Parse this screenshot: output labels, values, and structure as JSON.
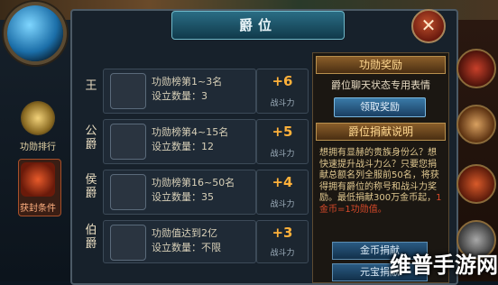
{
  "title": "爵位",
  "close_glyph": "✕",
  "left_menu": [
    {
      "label": "功勋排行"
    },
    {
      "label": "获封条件"
    }
  ],
  "ranks": [
    {
      "rank": "王",
      "line1": "功勋榜第1~3名",
      "line2": "设立数量：3",
      "power": "+6",
      "power_label": "战斗力"
    },
    {
      "rank": "公爵",
      "line1": "功勋榜第4~15名",
      "line2": "设立数量：12",
      "power": "+5",
      "power_label": "战斗力"
    },
    {
      "rank": "侯爵",
      "line1": "功勋榜第16~50名",
      "line2": "设立数量：35",
      "power": "+4",
      "power_label": "战斗力"
    },
    {
      "rank": "伯爵",
      "line1": "功勋值达到2亿",
      "line2": "设立数量：不限",
      "power": "+3",
      "power_label": "战斗力"
    }
  ],
  "reward": {
    "heading": "功勋奖励",
    "text": "爵位聊天状态专用表情",
    "claim_button": "领取奖励"
  },
  "donate": {
    "heading": "爵位捐献说明",
    "desc_main": "想拥有显赫的贵族身份么？想快速提升战斗力么？只要您捐献总额名列全服前50名，将获得拥有爵位的称号和战斗力奖励。",
    "desc_rule_a": "最低捐献300万金币起，",
    "desc_rule_b": "1金币=1功勋值。",
    "gold_button": "金币捐献",
    "other_button": "元宝捐献"
  },
  "watermark": "维普手游网"
}
